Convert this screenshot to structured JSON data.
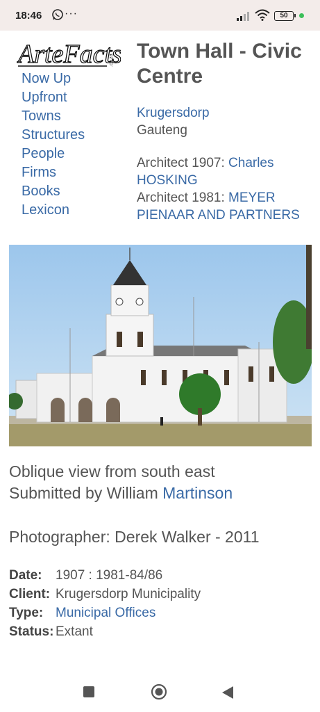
{
  "status": {
    "time": "18:46",
    "battery": "50",
    "more": "···"
  },
  "logo": {
    "text": "ArteFacts",
    "suffix": ".co.za"
  },
  "nav": [
    "Now Up",
    "Upfront",
    "Towns",
    "Structures",
    "People",
    "Firms",
    "Books",
    "Lexicon"
  ],
  "title": "Town Hall - Civic Centre",
  "location": {
    "town": "Krugersdorp",
    "province": "Gauteng"
  },
  "architects": [
    {
      "label": "Architect 1907: ",
      "name": "Charles HOSKING"
    },
    {
      "label": "Architect 1981: ",
      "name": "MEYER PIENAAR AND PARTNERS"
    }
  ],
  "caption": {
    "text": "Oblique view from south east",
    "submitted_label": "Submitted by William ",
    "submitted_link": "Martinson"
  },
  "photographer": "Photographer: Derek Walker - 2011",
  "meta": {
    "date_label": "Date:",
    "date_value": "1907 : 1981-84/86",
    "client_label": "Client:",
    "client_value": "Krugersdorp Municipality",
    "type_label": "Type:",
    "type_value": "Municipal Offices",
    "status_label": "Status:",
    "status_value": "Extant"
  },
  "colors": {
    "link": "#3a6aa6",
    "text": "#555555",
    "statusbar": "#f3ecea"
  }
}
